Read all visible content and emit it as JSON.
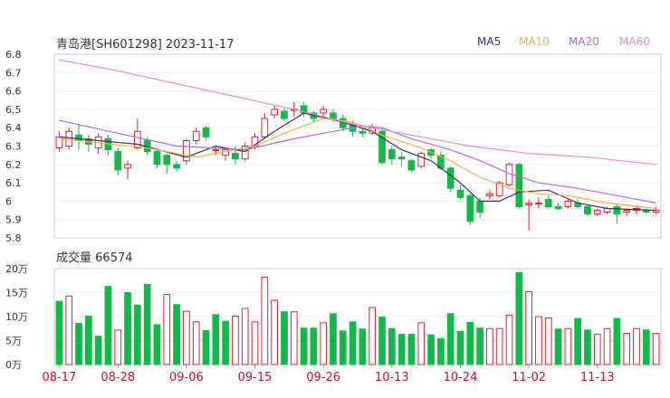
{
  "header": {
    "title": "青岛港[SH601298] 2023-11-17",
    "volume_label": "成交量",
    "volume_value": "66574"
  },
  "legend": [
    {
      "name": "MA5",
      "color": "#333366"
    },
    {
      "name": "MA10",
      "color": "#f5b041"
    },
    {
      "name": "MA20",
      "color": "#bb66dd"
    },
    {
      "name": "MA60",
      "color": "#ee88cc"
    }
  ],
  "colors": {
    "up": "#e0202c",
    "down": "#12b84a"
  },
  "chart_data": [
    {
      "type": "candlestick",
      "title": "青岛港[SH601298] 2023-11-17",
      "ylim": [
        5.8,
        6.8
      ],
      "yticks": [
        "6.8",
        "6.7",
        "6.6",
        "6.5",
        "6.4",
        "6.3",
        "6.2",
        "6.1",
        "6",
        "5.9",
        "5.8"
      ],
      "x_labels": [
        "08-17",
        "08-28",
        "09-06",
        "09-15",
        "09-26",
        "10-13",
        "10-24",
        "11-02",
        "11-13"
      ],
      "x_label_index": [
        0,
        6,
        13,
        20,
        27,
        34,
        41,
        48,
        55
      ],
      "candles": [
        [
          6.29,
          6.35,
          6.38,
          6.27
        ],
        [
          6.3,
          6.38,
          6.4,
          6.28
        ],
        [
          6.36,
          6.33,
          6.42,
          6.28
        ],
        [
          6.34,
          6.31,
          6.36,
          6.27
        ],
        [
          6.29,
          6.35,
          6.37,
          6.26
        ],
        [
          6.34,
          6.28,
          6.36,
          6.25
        ],
        [
          6.27,
          6.17,
          6.29,
          6.14
        ],
        [
          6.18,
          6.2,
          6.22,
          6.12
        ],
        [
          6.29,
          6.38,
          6.45,
          6.28
        ],
        [
          6.33,
          6.27,
          6.35,
          6.25
        ],
        [
          6.27,
          6.2,
          6.29,
          6.18
        ],
        [
          6.25,
          6.2,
          6.26,
          6.15
        ],
        [
          6.2,
          6.18,
          6.22,
          6.16
        ],
        [
          6.22,
          6.33,
          6.34,
          6.2
        ],
        [
          6.33,
          6.38,
          6.4,
          6.31
        ],
        [
          6.4,
          6.35,
          6.41,
          6.33
        ],
        [
          6.28,
          6.28,
          6.3,
          6.25
        ],
        [
          6.25,
          6.28,
          6.29,
          6.22
        ],
        [
          6.26,
          6.23,
          6.3,
          6.2
        ],
        [
          6.23,
          6.3,
          6.32,
          6.22
        ],
        [
          6.3,
          6.35,
          6.37,
          6.28
        ],
        [
          6.35,
          6.45,
          6.48,
          6.34
        ],
        [
          6.47,
          6.5,
          6.52,
          6.45
        ],
        [
          6.49,
          6.45,
          6.51,
          6.44
        ],
        [
          6.5,
          6.5,
          6.54,
          6.46
        ],
        [
          6.52,
          6.48,
          6.54,
          6.46
        ],
        [
          6.48,
          6.45,
          6.49,
          6.43
        ],
        [
          6.48,
          6.5,
          6.52,
          6.46
        ],
        [
          6.48,
          6.45,
          6.5,
          6.43
        ],
        [
          6.45,
          6.4,
          6.47,
          6.38
        ],
        [
          6.42,
          6.38,
          6.44,
          6.35
        ],
        [
          6.38,
          6.37,
          6.4,
          6.35
        ],
        [
          6.37,
          6.4,
          6.42,
          6.36
        ],
        [
          6.38,
          6.21,
          6.4,
          6.2
        ],
        [
          6.28,
          6.23,
          6.3,
          6.2
        ],
        [
          6.24,
          6.23,
          6.27,
          6.19
        ],
        [
          6.22,
          6.17,
          6.23,
          6.16
        ],
        [
          6.19,
          6.26,
          6.27,
          6.18
        ],
        [
          6.28,
          6.25,
          6.29,
          6.23
        ],
        [
          6.25,
          6.18,
          6.27,
          6.17
        ],
        [
          6.18,
          6.07,
          6.19,
          6.05
        ],
        [
          6.06,
          6.02,
          6.09,
          6.01
        ],
        [
          6.03,
          5.89,
          6.04,
          5.87
        ],
        [
          6.0,
          5.94,
          6.02,
          5.91
        ],
        [
          6.03,
          6.04,
          6.06,
          6.01
        ],
        [
          6.03,
          6.1,
          6.11,
          6.02
        ],
        [
          6.09,
          6.2,
          6.21,
          6.08
        ],
        [
          6.2,
          5.97,
          6.21,
          5.96
        ],
        [
          5.98,
          5.99,
          6.01,
          5.84
        ],
        [
          5.99,
          5.99,
          6.02,
          5.96
        ],
        [
          6.01,
          5.97,
          6.03,
          5.96
        ],
        [
          5.97,
          5.96,
          5.99,
          5.95
        ],
        [
          5.97,
          6.0,
          6.01,
          5.96
        ],
        [
          5.99,
          5.97,
          6.01,
          5.96
        ],
        [
          5.97,
          5.93,
          5.98,
          5.92
        ],
        [
          5.93,
          5.95,
          5.96,
          5.92
        ],
        [
          5.94,
          5.96,
          5.97,
          5.93
        ],
        [
          5.97,
          5.93,
          5.98,
          5.88
        ],
        [
          5.94,
          5.95,
          5.96,
          5.92
        ],
        [
          5.95,
          5.96,
          5.97,
          5.93
        ],
        [
          5.95,
          5.94,
          5.96,
          5.93
        ],
        [
          5.94,
          5.95,
          5.97,
          5.93
        ]
      ],
      "series": [
        {
          "name": "MA5",
          "color": "#333366",
          "points": [
            [
              0,
              6.35
            ],
            [
              8,
              6.31
            ],
            [
              13,
              6.24
            ],
            [
              16,
              6.3
            ],
            [
              19,
              6.27
            ],
            [
              22,
              6.38
            ],
            [
              25,
              6.48
            ],
            [
              29,
              6.43
            ],
            [
              32,
              6.38
            ],
            [
              35,
              6.28
            ],
            [
              38,
              6.22
            ],
            [
              41,
              6.1
            ],
            [
              43,
              6.0
            ],
            [
              45,
              6.0
            ],
            [
              47,
              6.05
            ],
            [
              50,
              6.06
            ],
            [
              53,
              5.99
            ],
            [
              56,
              5.96
            ],
            [
              61,
              5.95
            ]
          ]
        },
        {
          "name": "MA10",
          "color": "#f5b041",
          "points": [
            [
              0,
              6.34
            ],
            [
              9,
              6.29
            ],
            [
              14,
              6.24
            ],
            [
              20,
              6.3
            ],
            [
              23,
              6.37
            ],
            [
              27,
              6.45
            ],
            [
              30,
              6.43
            ],
            [
              33,
              6.36
            ],
            [
              37,
              6.29
            ],
            [
              40,
              6.22
            ],
            [
              43,
              6.13
            ],
            [
              46,
              6.07
            ],
            [
              49,
              6.04
            ],
            [
              52,
              6.03
            ],
            [
              56,
              5.99
            ],
            [
              61,
              5.96
            ]
          ]
        },
        {
          "name": "MA20",
          "color": "#bb66dd",
          "points": [
            [
              0,
              6.44
            ],
            [
              6,
              6.37
            ],
            [
              12,
              6.3
            ],
            [
              19,
              6.28
            ],
            [
              24,
              6.34
            ],
            [
              28,
              6.38
            ],
            [
              31,
              6.41
            ],
            [
              33,
              6.4
            ],
            [
              36,
              6.34
            ],
            [
              40,
              6.28
            ],
            [
              43,
              6.22
            ],
            [
              46,
              6.15
            ],
            [
              49,
              6.1
            ],
            [
              53,
              6.07
            ],
            [
              58,
              6.02
            ],
            [
              61,
              5.99
            ]
          ]
        },
        {
          "name": "MA60",
          "color": "#ee88cc",
          "points": [
            [
              0,
              6.77
            ],
            [
              6,
              6.71
            ],
            [
              12,
              6.64
            ],
            [
              18,
              6.57
            ],
            [
              24,
              6.5
            ],
            [
              30,
              6.42
            ],
            [
              36,
              6.36
            ],
            [
              42,
              6.3
            ],
            [
              48,
              6.26
            ],
            [
              54,
              6.24
            ],
            [
              61,
              6.2
            ]
          ]
        }
      ]
    },
    {
      "type": "bar",
      "title": "成交量",
      "ylim": [
        0,
        20
      ],
      "yticks": [
        "20万",
        "15万",
        "10万",
        "5万",
        "0万"
      ],
      "values": [
        13.2,
        14.3,
        8.6,
        10.1,
        5.9,
        16.3,
        7.2,
        15.0,
        12.4,
        16.7,
        8.3,
        14.6,
        12.5,
        11.1,
        8.9,
        7.1,
        10.4,
        9.0,
        10.1,
        11.7,
        8.9,
        18.2,
        13.4,
        11.0,
        11.0,
        7.6,
        7.6,
        8.7,
        10.6,
        7.0,
        8.9,
        7.4,
        11.9,
        9.9,
        7.5,
        6.3,
        6.3,
        8.7,
        6.2,
        5.4,
        10.6,
        6.9,
        8.8,
        7.6,
        7.5,
        7.5,
        10.3,
        19.2,
        15.2,
        10.0,
        9.7,
        7.4,
        7.5,
        9.6,
        7.2,
        6.3,
        7.5,
        9.6,
        6.5,
        7.5,
        7.2,
        6.5
      ],
      "up": [
        0,
        1,
        0,
        0,
        0,
        0,
        1,
        0,
        0,
        0,
        0,
        1,
        0,
        1,
        1,
        0,
        0,
        0,
        1,
        1,
        1,
        1,
        1,
        0,
        1,
        0,
        0,
        1,
        0,
        0,
        0,
        0,
        1,
        0,
        0,
        0,
        0,
        1,
        0,
        0,
        0,
        0,
        0,
        0,
        1,
        1,
        1,
        0,
        1,
        1,
        1,
        0,
        1,
        0,
        0,
        1,
        1,
        0,
        1,
        1,
        0,
        1
      ]
    }
  ]
}
